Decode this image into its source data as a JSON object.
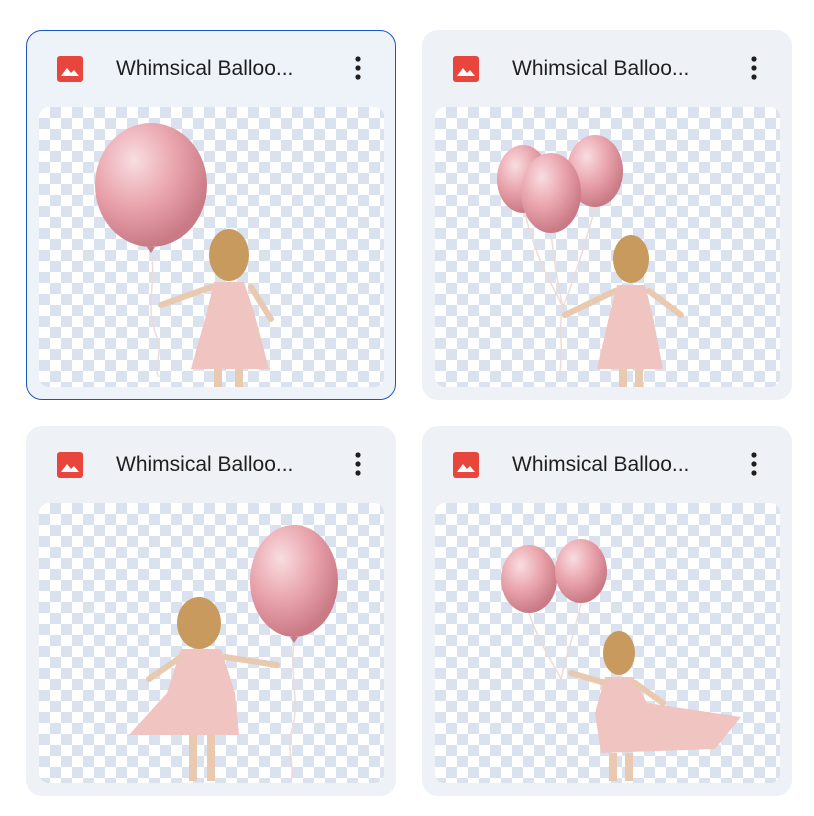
{
  "cards": [
    {
      "title": "Whimsical Balloo...",
      "file_type_icon": "image-file-icon",
      "menu_icon": "more-vert-icon",
      "selected": true
    },
    {
      "title": "Whimsical Balloo...",
      "file_type_icon": "image-file-icon",
      "menu_icon": "more-vert-icon",
      "selected": false
    },
    {
      "title": "Whimsical Balloo...",
      "file_type_icon": "image-file-icon",
      "menu_icon": "more-vert-icon",
      "selected": false
    },
    {
      "title": "Whimsical Balloo...",
      "file_type_icon": "image-file-icon",
      "menu_icon": "more-vert-icon",
      "selected": false
    }
  ],
  "colors": {
    "card_bg": "#eef1f6",
    "selected_border": "#1a56c4",
    "file_icon": "#e8453c",
    "balloon": "#e9a2ab",
    "dress": "#f0c4c0",
    "hair": "#c89a5e"
  }
}
